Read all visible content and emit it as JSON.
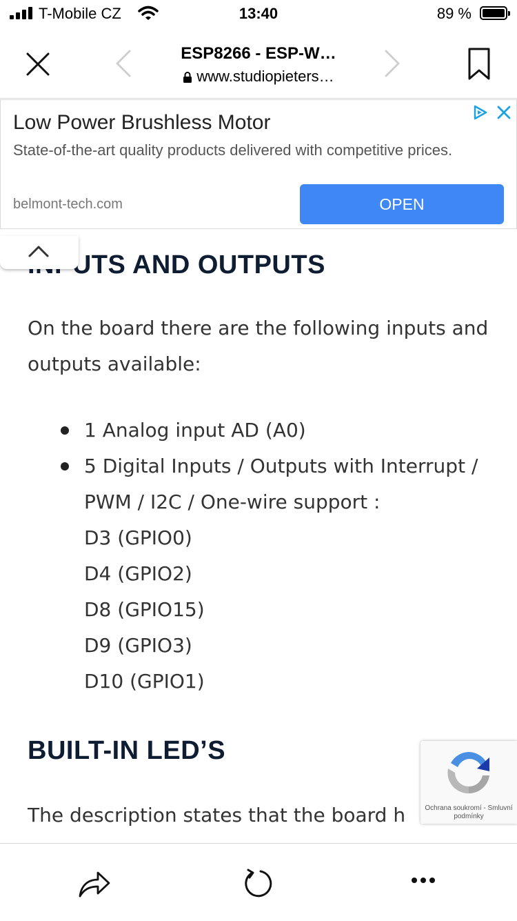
{
  "status_bar": {
    "carrier": "T-Mobile CZ",
    "time": "13:40",
    "battery": "89 %"
  },
  "nav": {
    "title": "ESP8266 - ESP-W…",
    "url": "www.studiopieters…"
  },
  "ad": {
    "title": "Low Power Brushless Motor",
    "description": "State-of-the-art quality products delivered with competitive prices.",
    "domain": "belmont-tech.com",
    "button": "OPEN"
  },
  "article": {
    "heading_inputs": "INPUTS AND OUTPUTS",
    "intro": "On the board there are the following inputs and outputs available:",
    "list": [
      "1 Analog input AD (A0)",
      "5 Digital Inputs / Outputs with Interrupt / PWM / I2C / One-wire support :"
    ],
    "pins": [
      "D3 (GPIO0)",
      "D4 (GPIO2)",
      "D8 (GPIO15)",
      "D9 (GPIO3)",
      "D10 (GPIO1)"
    ],
    "heading_led": "BUILT-IN LED’S",
    "led_text": "The description states that the board h"
  },
  "recaptcha": {
    "privacy": "Ochrana soukromí",
    "separator": " - ",
    "terms": "Smluvní podmínky"
  },
  "colors": {
    "accent_button": "#3e87f5",
    "heading": "#0f1d33",
    "adchoices": "#1aa3e0"
  }
}
